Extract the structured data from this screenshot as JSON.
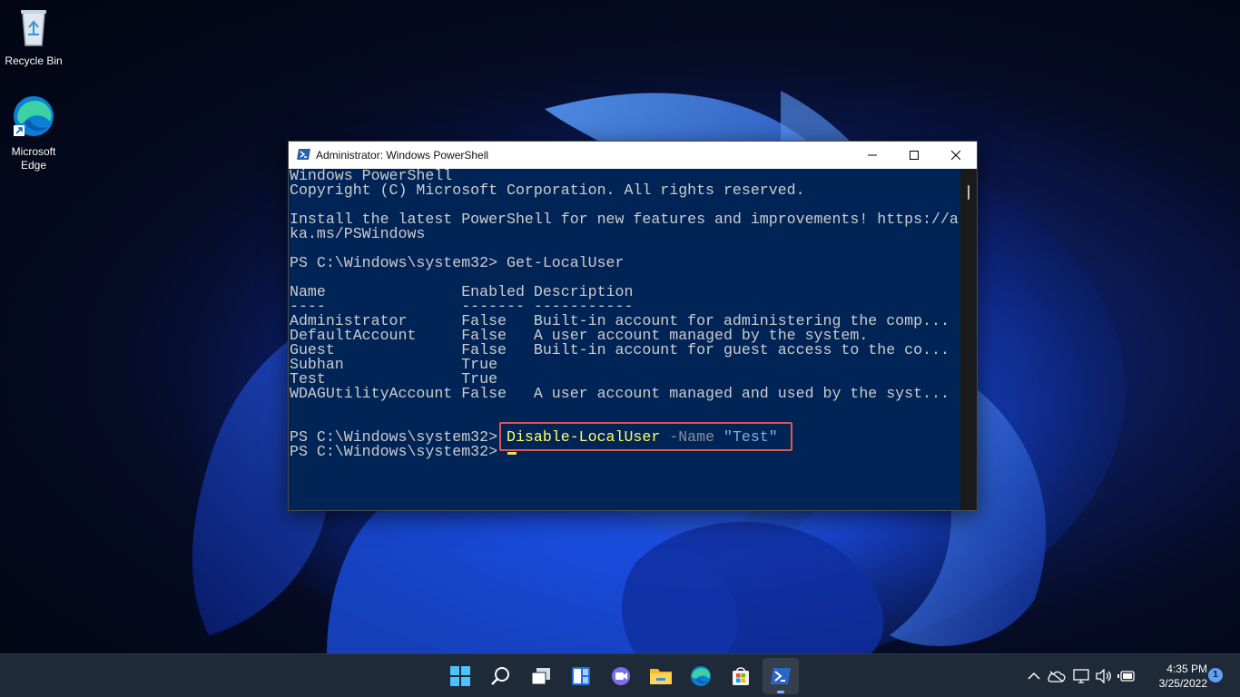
{
  "desktop": {
    "icons": [
      {
        "label": "Recycle Bin"
      },
      {
        "label": "Microsoft\nEdge"
      }
    ]
  },
  "window": {
    "title": "Administrator: Windows PowerShell",
    "console_lines": [
      "Windows PowerShell",
      "Copyright (C) Microsoft Corporation. All rights reserved.",
      "",
      "Install the latest PowerShell for new features and improvements! https://a",
      "ka.ms/PSWindows",
      "",
      "PS C:\\Windows\\system32> Get-LocalUser",
      "",
      "Name               Enabled Description",
      "----               ------- -----------",
      "Administrator      False   Built-in account for administering the comp...",
      "DefaultAccount     False   A user account managed by the system.",
      "Guest              False   Built-in account for guest access to the co...",
      "Subhan             True",
      "Test               True",
      "WDAGUtilityAccount False   A user account managed and used by the syst...",
      ""
    ],
    "command_line": {
      "prompt": "PS C:\\Windows\\system32> ",
      "cmdlet": "Disable-LocalUser",
      "param": " -Name ",
      "value": "\"Test\""
    },
    "final_prompt": "PS C:\\Windows\\system32>",
    "colors": {
      "console_bg": "#012456",
      "console_text": "#cccccc",
      "cmdlet": "#ffff66",
      "param": "#8a8f9a",
      "string": "#7fb3d8",
      "highlight": "#e05555"
    }
  },
  "taskbar": {
    "apps": [
      "start-icon",
      "search-icon",
      "task-view-icon",
      "widgets-icon",
      "teams-chat-icon",
      "file-explorer-icon",
      "edge-icon",
      "store-icon",
      "powershell-icon"
    ],
    "tray_icons": [
      "chevron-up-icon",
      "onedrive-icon",
      "display-icon",
      "volume-icon",
      "battery-icon"
    ],
    "time": "4:35 PM",
    "date": "3/25/2022",
    "notification_count": "1"
  }
}
